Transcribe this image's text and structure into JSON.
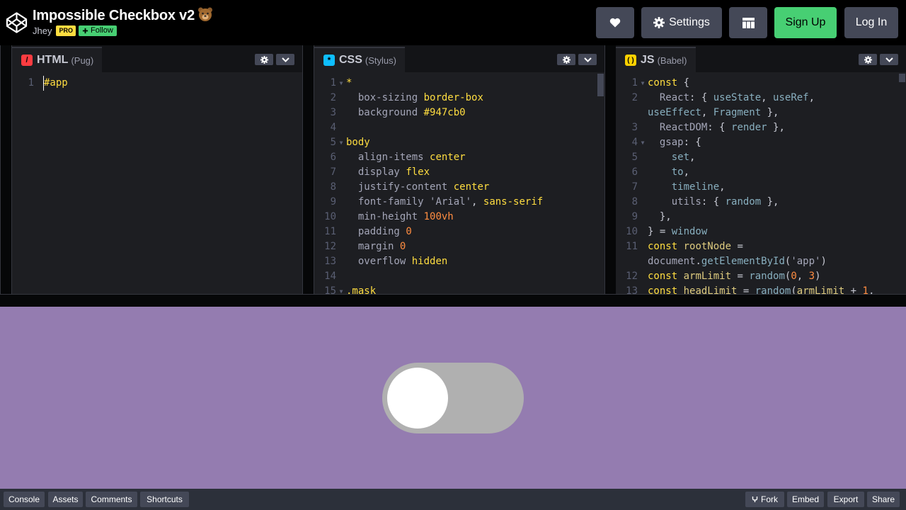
{
  "header": {
    "title": "Impossible Checkbox v2",
    "author": "Jhey",
    "pro_badge": "PRO",
    "follow_label": "Follow",
    "buttons": {
      "settings": "Settings",
      "signup": "Sign Up",
      "login": "Log In"
    }
  },
  "editors": {
    "html": {
      "name": "HTML",
      "lang": "(Pug)",
      "lines": [
        {
          "n": "1",
          "text": "#app"
        }
      ]
    },
    "css": {
      "name": "CSS",
      "lang": "(Stylus)",
      "lines": [
        {
          "n": "1",
          "text": "*"
        },
        {
          "n": "2",
          "text": "  box-sizing border-box"
        },
        {
          "n": "3",
          "text": "  background #947cb0"
        },
        {
          "n": "4",
          "text": ""
        },
        {
          "n": "5",
          "text": "body"
        },
        {
          "n": "6",
          "text": "  align-items center"
        },
        {
          "n": "7",
          "text": "  display flex"
        },
        {
          "n": "8",
          "text": "  justify-content center"
        },
        {
          "n": "9",
          "text": "  font-family 'Arial', sans-serif"
        },
        {
          "n": "10",
          "text": "  min-height 100vh"
        },
        {
          "n": "11",
          "text": "  padding 0"
        },
        {
          "n": "12",
          "text": "  margin 0"
        },
        {
          "n": "13",
          "text": "  overflow hidden"
        },
        {
          "n": "14",
          "text": ""
        },
        {
          "n": "15",
          "text": ".mask"
        }
      ]
    },
    "js": {
      "name": "JS",
      "lang": "(Babel)",
      "lines": [
        {
          "n": "1",
          "text": "const {"
        },
        {
          "n": "2",
          "text": "  React: { useState, useRef,"
        },
        {
          "n": "",
          "text": "useEffect, Fragment },"
        },
        {
          "n": "3",
          "text": "  ReactDOM: { render },"
        },
        {
          "n": "4",
          "text": "  gsap: {"
        },
        {
          "n": "5",
          "text": "    set,"
        },
        {
          "n": "6",
          "text": "    to,"
        },
        {
          "n": "7",
          "text": "    timeline,"
        },
        {
          "n": "8",
          "text": "    utils: { random },"
        },
        {
          "n": "9",
          "text": "  },"
        },
        {
          "n": "10",
          "text": "} = window"
        },
        {
          "n": "11",
          "text": "const rootNode ="
        },
        {
          "n": "",
          "text": "document.getElementById('app')"
        },
        {
          "n": "12",
          "text": "const armLimit = random(0, 3)"
        },
        {
          "n": "13",
          "text": "const headLimit = random(armLimit + 1,"
        }
      ]
    }
  },
  "footer": {
    "left": [
      "Console",
      "Assets",
      "Comments",
      "Shortcuts"
    ],
    "right": [
      "Fork",
      "Embed",
      "Export",
      "Share"
    ]
  },
  "icons": [
    "codepen-logo-icon",
    "bear-emoji-icon",
    "heart-icon",
    "gear-icon",
    "grid-layout-icon",
    "plus-icon",
    "chevron-down-icon",
    "fork-icon"
  ],
  "colors": {
    "preview_bg": "#947cb0",
    "signup_green": "#47cf73",
    "pro_yellow": "#ffdd40",
    "html_icon": "#ff3c41",
    "css_icon": "#0ebeff",
    "js_icon": "#fcd000"
  },
  "preview": {
    "toggle_state": "off"
  }
}
